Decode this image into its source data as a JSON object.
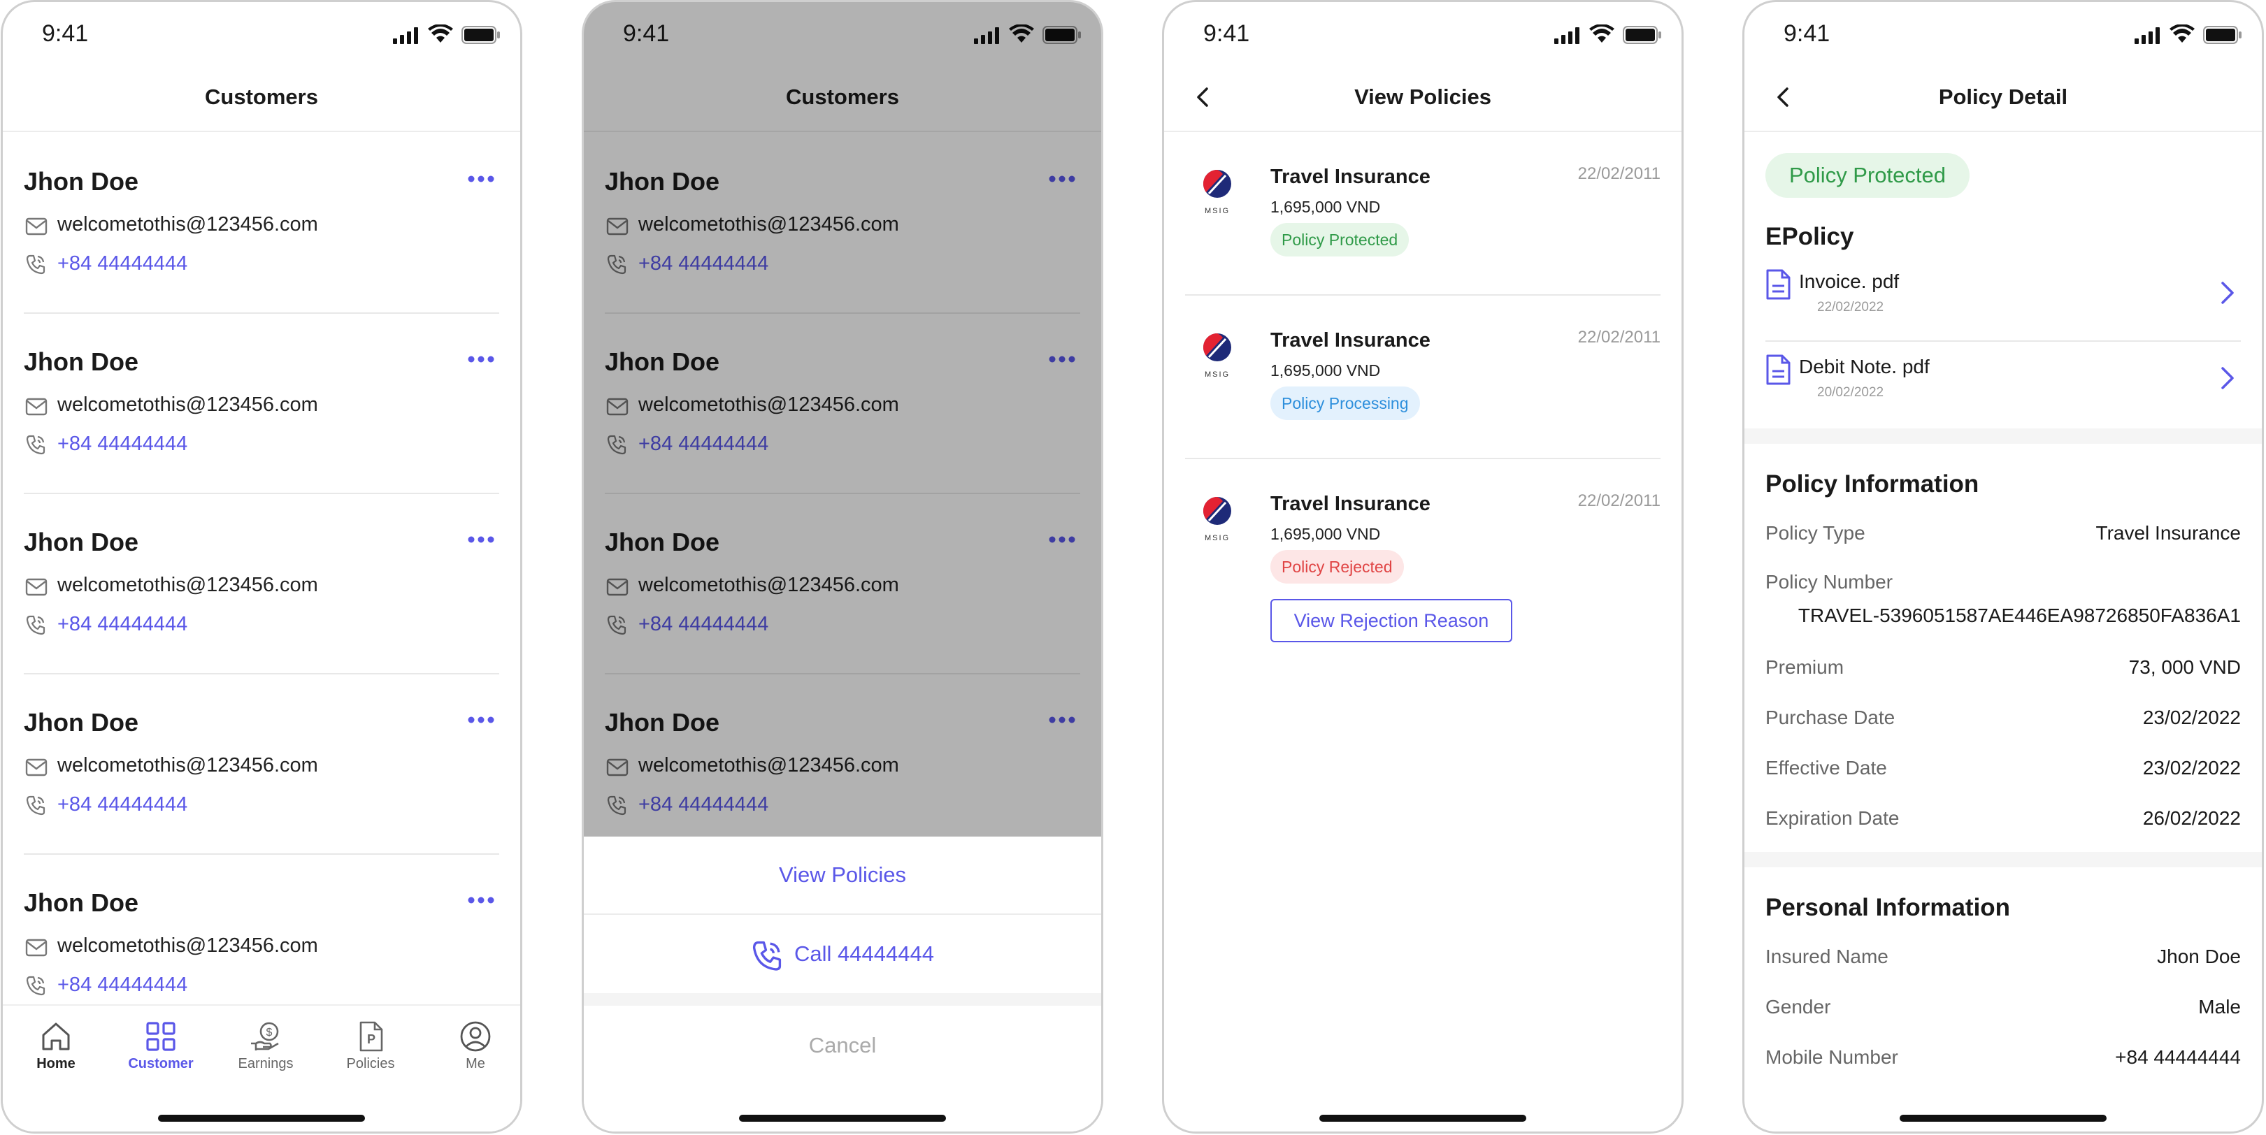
{
  "status": {
    "time": "9:41"
  },
  "screen1": {
    "title": "Customers",
    "customers": [
      {
        "name": "Jhon Doe",
        "email": "welcometothis@123456.com",
        "phone": "+84 44444444"
      },
      {
        "name": "Jhon Doe",
        "email": "welcometothis@123456.com",
        "phone": "+84 44444444"
      },
      {
        "name": "Jhon Doe",
        "email": "welcometothis@123456.com",
        "phone": "+84 44444444"
      },
      {
        "name": "Jhon Doe",
        "email": "welcometothis@123456.com",
        "phone": "+84 44444444"
      },
      {
        "name": "Jhon Doe",
        "email": "welcometothis@123456.com",
        "phone": "+84 44444444"
      }
    ],
    "tabs": [
      {
        "label": "Home",
        "icon": "home-icon"
      },
      {
        "label": "Customer",
        "icon": "grid-icon"
      },
      {
        "label": "Earnings",
        "icon": "earnings-icon"
      },
      {
        "label": "Policies",
        "icon": "policies-icon"
      },
      {
        "label": "Me",
        "icon": "user-icon"
      }
    ]
  },
  "screen2": {
    "title": "Customers",
    "sheet": {
      "view_policies": "View Policies",
      "call": "Call 44444444",
      "cancel": "Cancel"
    }
  },
  "screen3": {
    "title": "View Policies",
    "policies": [
      {
        "title": "Travel Insurance",
        "price": "1,695,000 VND",
        "date": "22/02/2011",
        "status": "Policy Protected"
      },
      {
        "title": "Travel Insurance",
        "price": "1,695,000 VND",
        "date": "22/02/2011",
        "status": "Policy Processing"
      },
      {
        "title": "Travel Insurance",
        "price": "1,695,000 VND",
        "date": "22/02/2011",
        "status": "Policy Rejected"
      }
    ],
    "reject_button": "View Rejection Reason",
    "logo_text": "MSIG"
  },
  "screen4": {
    "title": "Policy Detail",
    "status": "Policy Protected",
    "epolicy_title": "EPolicy",
    "documents": [
      {
        "name": "Invoice. pdf",
        "date": "22/02/2022"
      },
      {
        "name": "Debit Note. pdf",
        "date": "20/02/2022"
      }
    ],
    "policy_info_title": "Policy Information",
    "policy_type": {
      "label": "Policy Type",
      "value": "Travel Insurance"
    },
    "policy_number": {
      "label": "Policy Number",
      "value": "TRAVEL-5396051587AE446EA98726850FA836A1"
    },
    "premium": {
      "label": "Premium",
      "value": "73, 000 VND"
    },
    "purchase_date": {
      "label": "Purchase Date",
      "value": "23/02/2022"
    },
    "effective_date": {
      "label": "Effective Date",
      "value": "23/02/2022"
    },
    "expiration_date": {
      "label": "Expiration Date",
      "value": "26/02/2022"
    },
    "personal_info_title": "Personal Information",
    "insured_name": {
      "label": "Insured Name",
      "value": "Jhon Doe"
    },
    "gender": {
      "label": "Gender",
      "value": "Male"
    },
    "mobile": {
      "label": "Mobile Number",
      "value": "+84 44444444"
    }
  },
  "colors": {
    "accent": "#5a57e8",
    "green": "#2f9a48",
    "blue": "#2d8fdc",
    "red": "#e04444"
  }
}
